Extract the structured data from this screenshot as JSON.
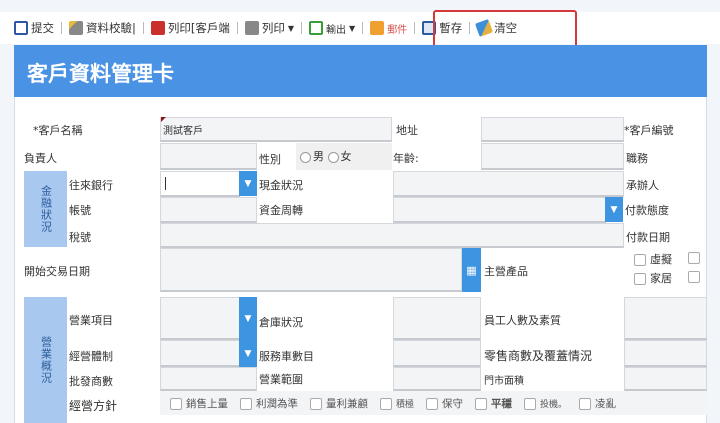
{
  "toolbar": {
    "submit": "提交",
    "verify": "資料校驗|",
    "print_client": "列印[客戶端",
    "print": "列印",
    "export": "輸出",
    "mail": "郵件",
    "save_draft": "暫存",
    "clear": "清空"
  },
  "header": {
    "title": "客戶資料管理卡"
  },
  "form": {
    "customer_name_label": "*客戶名稱",
    "customer_name_value": "測試客戶",
    "address_label": "地址",
    "customer_no_label": "*客戶編號",
    "owner_label": "負責人",
    "gender_label": "性別",
    "gender_male": "男",
    "gender_female": "女",
    "age_label": "年齡:",
    "position_label": "職務",
    "finance_section": "金融狀況",
    "bank_label": "往來銀行",
    "cash_label": "現金狀況",
    "handler_label": "承辦人",
    "account_label": "帳號",
    "turnover_label": "資金周轉",
    "payment_attitude_label": "付款態度",
    "tax_label": "稅號",
    "payment_date_label": "付款日期",
    "start_date_label": "開始交易日期",
    "main_product_label": "主營產品",
    "product_virtual": "虛擬",
    "product_home": "家居",
    "business_section": "營業概況",
    "business_items_label": "營業項目",
    "warehouse_label": "倉庫狀況",
    "staff_label": "員工人數及素質",
    "business_system_label": "經營體制",
    "service_cars_label": "服務車數目",
    "retail_label": "零售商數及覆蓋情況",
    "wholesale_label": "批發商數",
    "business_scope_label": "營業範圍",
    "store_area_label": "門市面積",
    "policy_label": "經營方針",
    "policy_options": [
      "銷售上量",
      "利潤為準",
      "量利兼顧",
      "積極",
      "保守",
      "平穩",
      "投機。",
      "凌亂"
    ]
  }
}
